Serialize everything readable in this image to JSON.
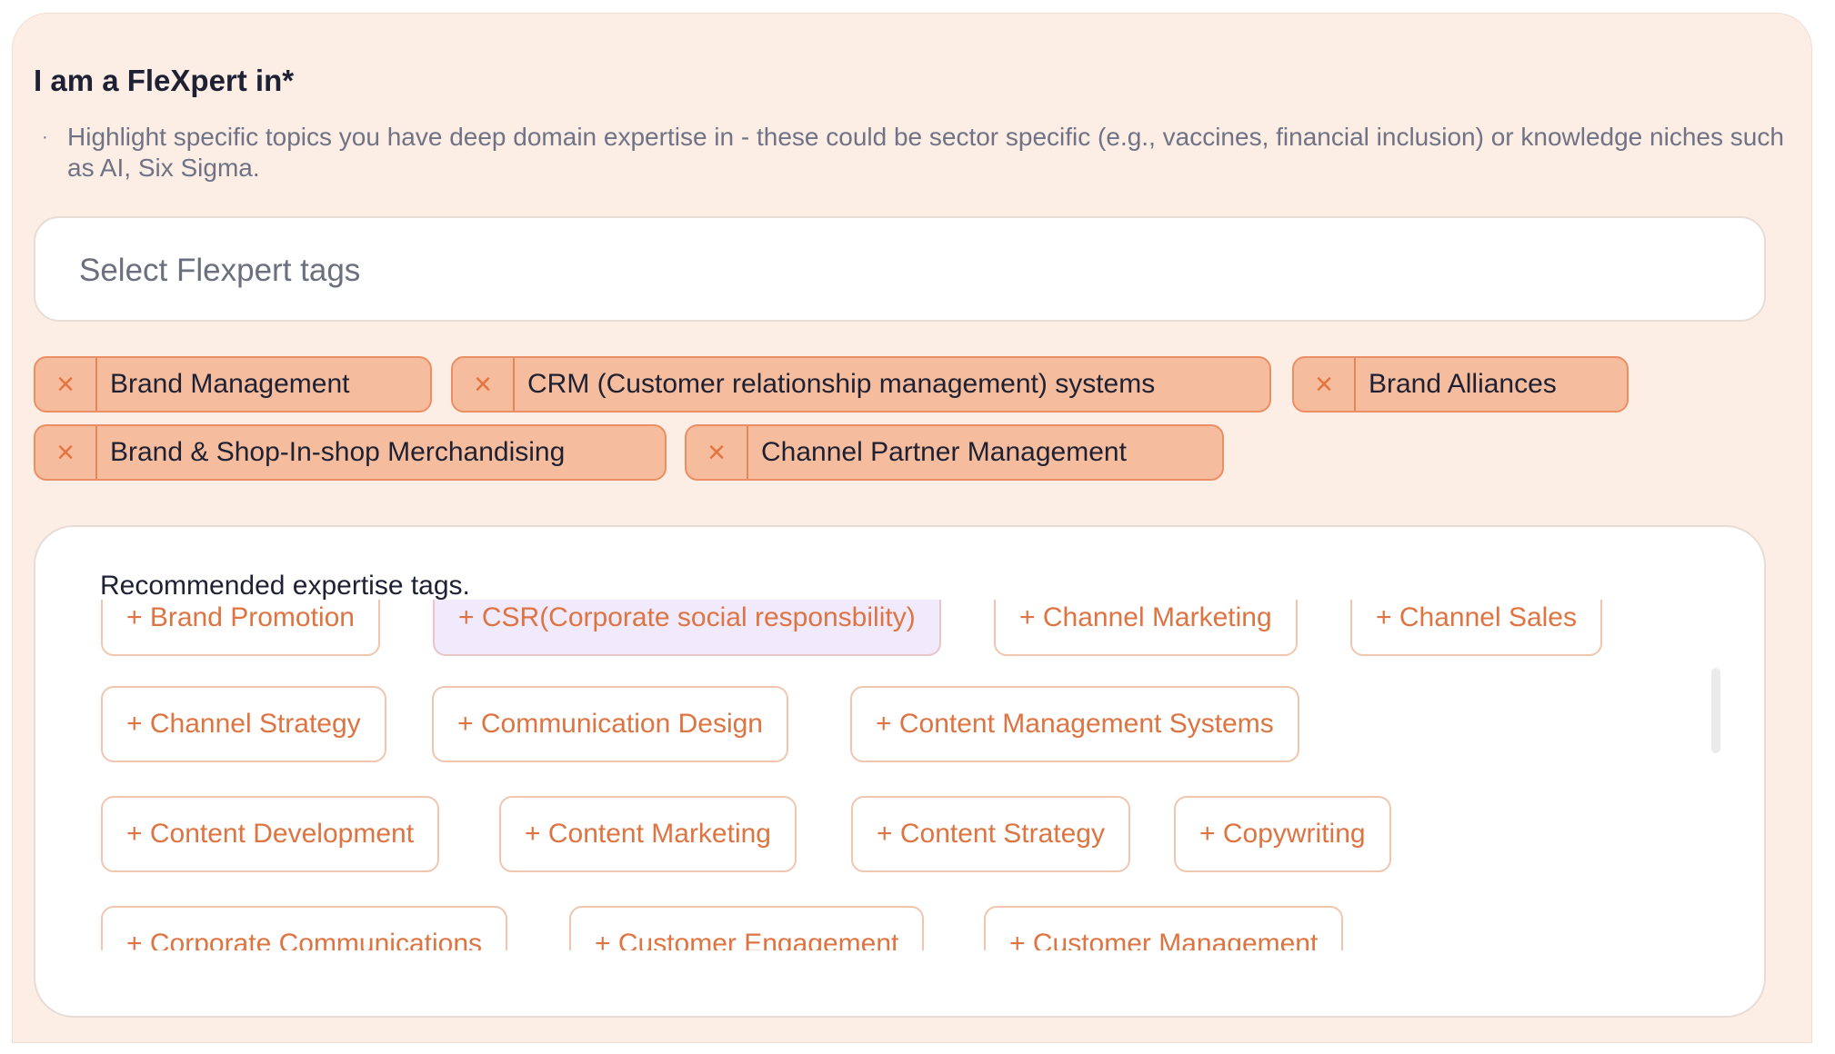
{
  "section": {
    "title": "I am a FleXpert in*",
    "helper_bullet": "·",
    "helper_text": "Highlight specific topics you have deep domain expertise in - these could be sector specific (e.g., vaccines, financial inclusion) or knowledge niches such as AI, Six Sigma."
  },
  "select": {
    "placeholder": "Select Flexpert tags"
  },
  "selected_tags": [
    {
      "label": "Brand Management"
    },
    {
      "label": "CRM (Customer relationship management) systems"
    },
    {
      "label": "Brand Alliances"
    },
    {
      "label": "Brand & Shop-In-shop Merchandising"
    },
    {
      "label": "Channel Partner Management"
    }
  ],
  "remove_icon": "×",
  "recommended": {
    "title": "Recommended expertise tags.",
    "tags": [
      {
        "label": "+ Brand Promotion"
      },
      {
        "label": "+ CSR(Corporate social responsbility)",
        "highlighted": true
      },
      {
        "label": "+ Channel Marketing"
      },
      {
        "label": "+ Channel Sales"
      },
      {
        "label": "+ Channel Strategy"
      },
      {
        "label": "+ Communication Design"
      },
      {
        "label": "+ Content Management Systems"
      },
      {
        "label": "+ Content Development"
      },
      {
        "label": "+ Content Marketing"
      },
      {
        "label": "+ Content Strategy"
      },
      {
        "label": "+ Copywriting"
      },
      {
        "label": "+ Corporate Communications"
      },
      {
        "label": "+ Customer Engagement"
      },
      {
        "label": "+ Customer Management"
      }
    ]
  },
  "colors": {
    "panel_bg": "#fcede5",
    "chip_bg": "#f5bc9d",
    "chip_border": "#ea8f63",
    "accent": "#dd7442",
    "highlight_bg": "#f1eafc"
  }
}
